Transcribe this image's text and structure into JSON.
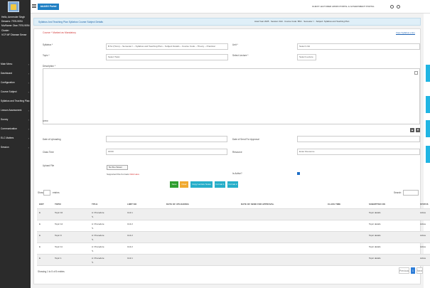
{
  "sidebar": {
    "user_lines": [
      "Hello, Amrender Singh",
      "Dessers: 7976-9094",
      "Mo/Name: Dian 7976-9094",
      "Cluster:",
      "VCF MF Disease Sense"
    ],
    "menu": [
      "Main Menu",
      "Dashboard",
      "Configuration",
      "Course Subject",
      "Syllabus and Teaching Plan",
      "Lesson Assessment",
      "Survey",
      "Communication",
      "ELC Matters",
      "Session"
    ]
  },
  "topbar": {
    "brand": "AAASG Portal",
    "link": "GUEST LECTURER ADMIN PORTAL & GOVERNMENT PORTAL",
    "home_icon": "home-icon",
    "power_icon": "power-icon"
  },
  "breadcrumb": "Syllabus And Teaching Plan   Syllabus   Course Subject Details",
  "meta": "Acad Year 2025 · Session Odd · Course Code: BSC · Semester: I · Subject: Syllabus and Teaching Plan",
  "form": {
    "title": "Course * Marked as Mandatory",
    "view_link": "View Syllabus entry",
    "labels": {
      "syllabus": "Syllabus *",
      "unit": "Unit *",
      "topic": "Topic *",
      "select_lecture": "Select Lecture *",
      "description": "Description *",
      "date_uploading": "Date of Uploading",
      "date_approval": "Date of Send For Approval",
      "class_time": "Class Time",
      "resource": "Resource",
      "upload_file": "Upload File",
      "is_active": "Is Active?"
    },
    "values": {
      "syllabus": "B.Sc (Hons) – Semester I – Syllabus and Teaching Plan – Subject Details – Course Code – Theory – Practical",
      "unit": "Select Unit",
      "topic": "Select Topic",
      "select_lecture": "Select Lecture",
      "class_time": "00:00",
      "resource": "Enter Resource",
      "choose_file": "No file chosen",
      "support_text": "Supported File Formats ",
      "support_link": "Click Here",
      "char_count": "0/250"
    },
    "buttons": {
      "save": "Save",
      "clear": "Clear",
      "copy": "Copy Lecture Notes",
      "format1": "Format 1",
      "format2": "Format 2"
    }
  },
  "table": {
    "show": "Show",
    "entries": "entries",
    "search": "Search:",
    "headers": [
      "EDIT",
      "TOPIC",
      "TITLE",
      "LIMIT NO",
      "DATE OF UPLOADING",
      "DATE OF SEND FOR APPROVAL",
      "CLASS TIME",
      "SUBMITTED ON",
      "STATUS"
    ],
    "rows": [
      [
        "E",
        "Topic 10",
        "A: Procedure",
        "Unit 1",
        "",
        "",
        "",
        "Topic details",
        "Active"
      ],
      [
        "E",
        "Topic 12",
        "A: Procedure",
        "Unit 2",
        "",
        "",
        "",
        "Topic details",
        "Active"
      ],
      [
        "E",
        "Topic 9",
        "A: Procedure",
        "Unit 2",
        "",
        "",
        "",
        "Topic details",
        "Active"
      ],
      [
        "E",
        "Topic 11",
        "A: Procedure",
        "Unit 2",
        "",
        "",
        "",
        "Topic details",
        "Active"
      ],
      [
        "E",
        "Topic 1",
        "A: Procedure",
        "Unit 1",
        "",
        "",
        "",
        "Topic details",
        "Active"
      ]
    ],
    "showing": "Showing 1 to 5 of 5 entries",
    "prev": "Previous",
    "page": "1",
    "next": "Next"
  }
}
